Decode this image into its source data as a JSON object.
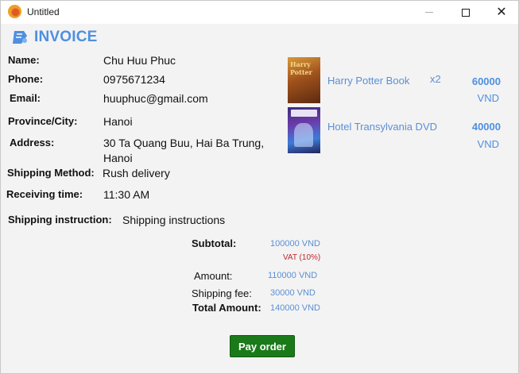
{
  "window": {
    "title": "Untitled",
    "controls": {
      "minimize": "—",
      "maximize": "□",
      "close": "✕"
    }
  },
  "invoice": {
    "heading": "INVOICE",
    "icon": "invoice-ticket-icon"
  },
  "customer": {
    "name_label": "Name:",
    "name": "Chu Huu Phuc",
    "phone_label": "Phone:",
    "phone": "0975671234",
    "email_label": "Email:",
    "email": "huuphuc@gmail.com",
    "province_label": "Province/City:",
    "province": "Hanoi",
    "address_label": "Address:",
    "address_line1": "30 Ta Quang Buu, Hai Ba Trung,",
    "address_line2": "Hanoi",
    "shipping_method_label": "Shipping Method:",
    "shipping_method": "Rush delivery",
    "receiving_time_label": "Receiving time:",
    "receiving_time": "11:30 AM",
    "shipping_instruction_label": "Shipping instruction:",
    "shipping_instruction": "Shipping instructions"
  },
  "items": [
    {
      "name": "Harry Potter Book",
      "quantity": "x2",
      "price": "60000",
      "currency": "VND",
      "cover_text": "Harry Potter"
    },
    {
      "name": "Hotel Transylvania DVD",
      "quantity": "",
      "price": "40000",
      "currency": "VND"
    }
  ],
  "summary": {
    "subtotal_label": "Subtotal:",
    "subtotal": "100000 VND",
    "vat": "VAT (10%)",
    "amount_label": "Amount:",
    "amount": "110000 VND",
    "shipping_fee_label": "Shipping fee:",
    "shipping_fee": "30000 VND",
    "total_label": "Total Amount:",
    "total": "140000 VND"
  },
  "actions": {
    "pay_label": "Pay order"
  },
  "colors": {
    "accent": "#4f8fe0",
    "pay_button": "#1a7a1a",
    "vat": "#c0282d"
  }
}
